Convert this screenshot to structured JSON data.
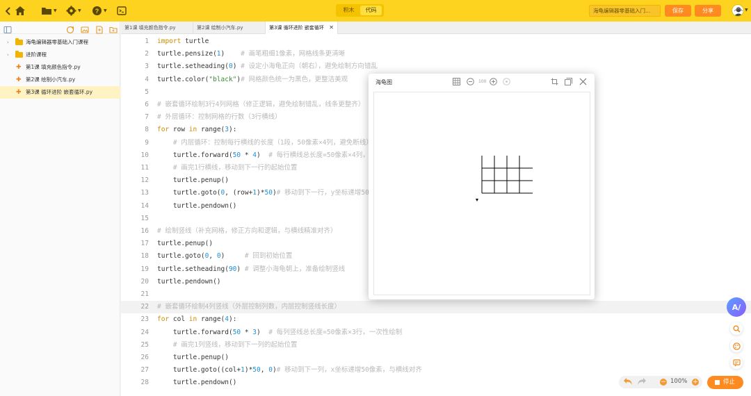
{
  "toolbar": {
    "mode_tabs": [
      "积木",
      "代码"
    ],
    "active_mode": "代码",
    "project_name": "海龟编辑器零基础入门...",
    "save_label": "保存",
    "share_label": "分享"
  },
  "sidebar": {
    "items": [
      {
        "label": "海龟编辑器零基础入门课程",
        "type": "folder"
      },
      {
        "label": "进阶课程",
        "type": "folder"
      },
      {
        "label": "第1课 填充颜色指令.py",
        "type": "file"
      },
      {
        "label": "第2课 绘制小汽车.py",
        "type": "file"
      },
      {
        "label": "第3课 循环进阶 嵌套循环.py",
        "type": "file",
        "active": true
      }
    ]
  },
  "tabs": [
    {
      "label": "第1课 填充颜色指令.py"
    },
    {
      "label": "第2课 绘制小汽车.py"
    },
    {
      "label": "第3课 循环进阶 嵌套循环",
      "active": true
    }
  ],
  "editor": {
    "lines": [
      {
        "n": "1",
        "html": "<span class=\"k\">import</span> turtle"
      },
      {
        "n": "2",
        "html": "turtle.pensize(<span class=\"n\">1</span>)    <span class=\"c\"># 画笔粗细1像素，网格线条更清晰</span>"
      },
      {
        "n": "3",
        "html": "turtle.setheading(<span class=\"n\">0</span>) <span class=\"c\"># 设定小海龟正向（朝右），避免绘制方向错乱</span>"
      },
      {
        "n": "4",
        "html": "turtle.color(<span class=\"s\">\"black\"</span>)<span class=\"c\"># 网格颜色统一为黑色，更整洁美观</span>"
      },
      {
        "n": "5",
        "html": ""
      },
      {
        "n": "6",
        "html": "<span class=\"c\"># 嵌套循环绘制3行4列网格（修正逻辑，避免绘制错乱，线条更整齐）</span>"
      },
      {
        "n": "7",
        "html": "<span class=\"c\"># 外层循环：控制网格的行数（3行横线）</span>"
      },
      {
        "n": "8",
        "html": "<span class=\"k\">for</span> row <span class=\"k\">in</span> range(<span class=\"n\">3</span>):"
      },
      {
        "n": "9",
        "html": "    <span class=\"c\"># 内层循环：控制每行横线的长度（1段，50像素×4列，避免断线）</span>"
      },
      {
        "n": "10",
        "html": "    turtle.forward(<span class=\"n\">50</span> * <span class=\"n\">4</span>)  <span class=\"c\"># 每行横线总长度=50像素×4列，一次性绘制</span>"
      },
      {
        "n": "11",
        "html": "    <span class=\"c\"># 画完1行横线，移动到下一行的起始位置</span>"
      },
      {
        "n": "12",
        "html": "    turtle.penup()"
      },
      {
        "n": "13",
        "html": "    turtle.goto(<span class=\"n\">0</span>, (row+<span class=\"n\">1</span>)*<span class=\"n\">50</span>)<span class=\"c\"># 移动到下一行，y坐标递增50像素</span>"
      },
      {
        "n": "14",
        "html": "    turtle.pendown()"
      },
      {
        "n": "15",
        "html": ""
      },
      {
        "n": "16",
        "html": "<span class=\"c\"># 绘制竖线（补充网格，修正方向和逻辑，与横线精准对齐）</span>"
      },
      {
        "n": "17",
        "html": "turtle.penup()"
      },
      {
        "n": "18",
        "html": "turtle.goto(<span class=\"n\">0</span>, <span class=\"n\">0</span>)     <span class=\"c\"># 回到初始位置</span>"
      },
      {
        "n": "19",
        "html": "turtle.setheading(<span class=\"n\">90</span>) <span class=\"c\"># 调整小海龟朝上，准备绘制竖线</span>"
      },
      {
        "n": "20",
        "html": "turtle.pendown()"
      },
      {
        "n": "21",
        "html": ""
      },
      {
        "n": "22",
        "html": "<span class=\"c\"># 嵌套循环绘制4列竖线（外层控制列数，内层控制竖线长度）</span>",
        "hl": true
      },
      {
        "n": "23",
        "html": "<span class=\"k\">for</span> col <span class=\"k\">in</span> range(<span class=\"n\">4</span>):"
      },
      {
        "n": "24",
        "html": "    turtle.forward(<span class=\"n\">50</span> * <span class=\"n\">3</span>)  <span class=\"c\"># 每列竖线总长度=50像素×3行，一次性绘制</span>"
      },
      {
        "n": "25",
        "html": "    <span class=\"c\"># 画完1列竖线，移动到下一列的起始位置</span>"
      },
      {
        "n": "26",
        "html": "    turtle.penup()"
      },
      {
        "n": "27",
        "html": "    turtle.goto((col+<span class=\"n\">1</span>)*<span class=\"n\">50</span>, <span class=\"n\">0</span>)<span class=\"c\"># 移动到下一列，x坐标递增50像素，与横线对齐</span>"
      },
      {
        "n": "28",
        "html": "    turtle.pendown()"
      }
    ]
  },
  "turtle_window": {
    "title": "海龟图",
    "zoom_label": "100"
  },
  "bottom": {
    "zoom": "100%",
    "stop_label": "停止"
  },
  "colors": {
    "brand_yellow": "#fdd31f",
    "accent_orange": "#ff8a1f"
  }
}
